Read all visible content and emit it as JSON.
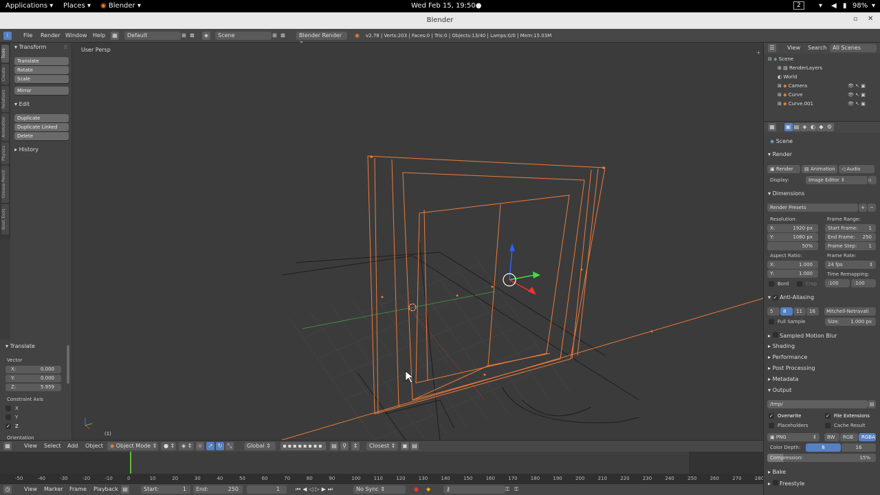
{
  "topbar": {
    "applications": "Applications",
    "places": "Places",
    "blender": "Blender",
    "clock": "Wed Feb 15, 19:50●",
    "workspace": "2",
    "battery": "98%"
  },
  "window": {
    "title": "Blender"
  },
  "info_header": {
    "menus": [
      "File",
      "Render",
      "Window",
      "Help"
    ],
    "layout": "Default",
    "scene": "Scene",
    "engine": "Blender Render",
    "stats": "v2.78 | Verts:203 | Faces:0 | Tris:0 | Objects:13/40 | Lamps:0/0 | Mem:15.03M"
  },
  "viewport": {
    "label": "User Persp",
    "frame_label": "(1)"
  },
  "tool_tabs": [
    "Tools",
    "Create",
    "Relations",
    "Animation",
    "Physics",
    "Grease Pencil",
    "Boot Tools"
  ],
  "toolshelf": {
    "transform_title": "Transform",
    "transform_buttons": [
      "Translate",
      "Rotate",
      "Scale"
    ],
    "mirror": "Mirror",
    "edit_title": "Edit",
    "edit_buttons": [
      "Duplicate",
      "Duplicate Linked",
      "Delete"
    ],
    "history_title": "History"
  },
  "last_operator": {
    "title": "Translate",
    "vector_label": "Vector",
    "x": "X:",
    "x_val": "0.000",
    "y": "Y:",
    "y_val": "0.000",
    "z": "Z:",
    "z_val": "5.959",
    "constraint_label": "Constraint Axis",
    "axes": [
      "X",
      "Y",
      "Z"
    ],
    "orientation": "Orientation"
  },
  "view3d_header": {
    "menus": [
      "View",
      "Select",
      "Add",
      "Object"
    ],
    "mode": "Object Mode",
    "orientation": "Global",
    "snap": "Closest"
  },
  "timeline": {
    "ticks": [
      "-50",
      "-40",
      "-30",
      "-20",
      "-10",
      "0",
      "10",
      "20",
      "30",
      "40",
      "50",
      "60",
      "70",
      "80",
      "90",
      "100",
      "110",
      "120",
      "130",
      "140",
      "150",
      "160",
      "170",
      "180",
      "190",
      "200",
      "210",
      "220",
      "230",
      "240",
      "250",
      "260",
      "270",
      "280"
    ],
    "current_frame_marker": 0
  },
  "timeline_header": {
    "menus": [
      "View",
      "Marker",
      "Frame",
      "Playback"
    ],
    "start_label": "Start:",
    "start_val": "1",
    "end_label": "End:",
    "end_val": "250",
    "current": "1",
    "sync": "No Sync"
  },
  "outliner": {
    "view": "View",
    "search": "Search",
    "filter": "All Scenes",
    "items": [
      "Scene",
      "RenderLayers",
      "World",
      "Camera",
      "Curve",
      "Curve.001"
    ]
  },
  "properties": {
    "breadcrumb": "Scene",
    "render_title": "Render",
    "render_btn": "Render",
    "animation_btn": "Animation",
    "audio_btn": "Audio",
    "display_label": "Display:",
    "display_val": "Image Editor",
    "dimensions_title": "Dimensions",
    "render_presets": "Render Presets",
    "resolution_label": "Resolution:",
    "res_x": "X:",
    "res_x_val": "1920 px",
    "res_y": "Y:",
    "res_y_val": "1080 px",
    "res_pct": "50%",
    "frame_range_label": "Frame Range:",
    "start_frame": "Start Frame:",
    "start_frame_val": "1",
    "end_frame": "End Frame:",
    "end_frame_val": "250",
    "frame_step": "Frame Step:",
    "frame_step_val": "1",
    "aspect_label": "Aspect Ratio:",
    "asp_x": "X:",
    "asp_x_val": "1.000",
    "asp_y": "Y:",
    "asp_y_val": "1.000",
    "frame_rate_label": "Frame Rate:",
    "fps": "24 fps",
    "time_remap_label": "Time Remapping:",
    "remap_old": ":100",
    "remap_new": ":100",
    "bord": "Bord",
    "crop": "Crop",
    "aa_title": "Anti-Aliasing",
    "aa_samples": [
      "5",
      "8",
      "11",
      "16"
    ],
    "aa_filter": "Mitchell-Netravali",
    "full_sample": "Full Sample",
    "size_label": "Size:",
    "size_val": "1.000 px",
    "collapsed": [
      "Sampled Motion Blur",
      "Shading",
      "Performance",
      "Post Processing",
      "Metadata"
    ],
    "output_title": "Output",
    "output_path": "/tmp/",
    "overwrite": "Overwrite",
    "file_ext": "File Extensions",
    "placeholders": "Placeholders",
    "cache_result": "Cache Result",
    "format": "PNG",
    "bw": "BW",
    "rgb": "RGB",
    "rgba": "RGBA",
    "color_depth_label": "Color Depth:",
    "depth_8": "8",
    "depth_16": "16",
    "compression": "Compression:",
    "compression_val": "15%",
    "bake": "Bake",
    "freestyle": "Freestyle"
  },
  "colors": {
    "accent": "#5680c2",
    "wire": "#f07b3a",
    "ui_bg": "#424242"
  }
}
